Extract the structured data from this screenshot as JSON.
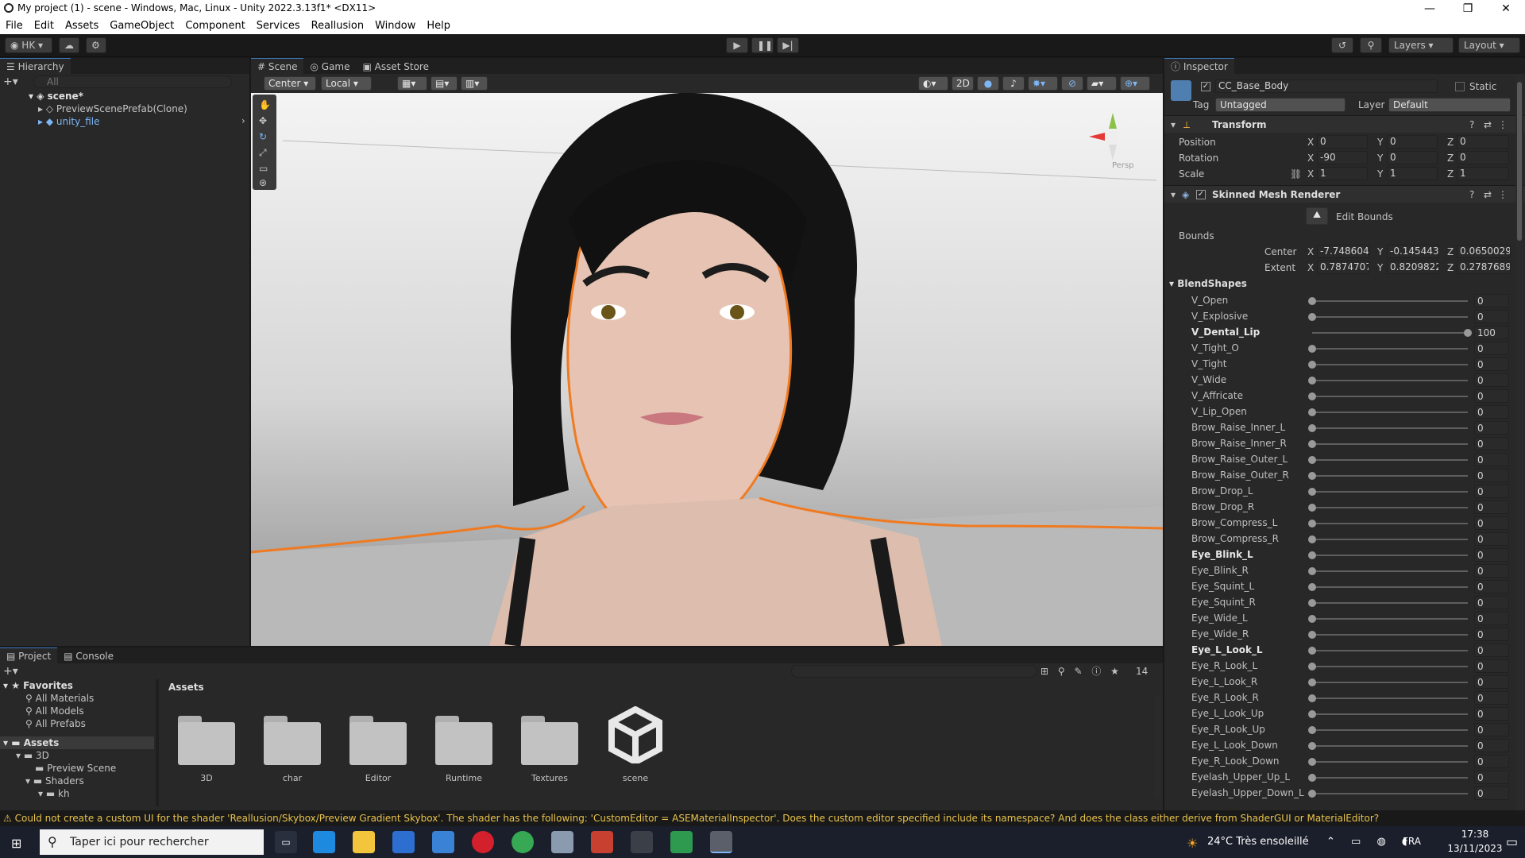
{
  "window": {
    "title": "My project (1) - scene - Windows, Mac, Linux - Unity 2022.3.13f1* <DX11>",
    "minimize": "—",
    "maximize": "❐",
    "close": "✕"
  },
  "menu": [
    "File",
    "Edit",
    "Assets",
    "GameObject",
    "Component",
    "Services",
    "Reallusion",
    "Window",
    "Help"
  ],
  "toolbar": {
    "account": "HK",
    "layers": "Layers",
    "layout": "Layout"
  },
  "hierarchy": {
    "tab": "Hierarchy",
    "search_placeholder": "All",
    "scene": "scene*",
    "items": [
      "PreviewScenePrefab(Clone)",
      "unity_file"
    ]
  },
  "scene_view": {
    "tabs": [
      "Scene",
      "Game",
      "Asset Store"
    ],
    "pivot": "Center",
    "space": "Local",
    "mode_2d": "2D",
    "persp_label": "Persp"
  },
  "inspector": {
    "tab": "Inspector",
    "object_name": "CC_Base_Body",
    "static_label": "Static",
    "tag_label": "Tag",
    "tag_value": "Untagged",
    "layer_label": "Layer",
    "layer_value": "Default",
    "transform": {
      "title": "Transform",
      "position": {
        "label": "Position",
        "x": "0",
        "y": "0",
        "z": "0"
      },
      "rotation": {
        "label": "Rotation",
        "x": "-90",
        "y": "0",
        "z": "0"
      },
      "scale": {
        "label": "Scale",
        "x": "1",
        "y": "1",
        "z": "1"
      }
    },
    "smr": {
      "title": "Skinned Mesh Renderer",
      "edit_bounds": "Edit Bounds",
      "bounds_label": "Bounds",
      "center": {
        "label": "Center",
        "x": "-7.748604",
        "y": "-0.145443",
        "z": "0.0650029"
      },
      "extent": {
        "label": "Extent",
        "x": "0.7874707",
        "y": "0.8209822",
        "z": "0.2787689"
      }
    },
    "blendshapes_title": "BlendShapes",
    "blendshapes": [
      {
        "name": "V_Open",
        "value": 0,
        "bold": false
      },
      {
        "name": "V_Explosive",
        "value": 0,
        "bold": false
      },
      {
        "name": "V_Dental_Lip",
        "value": 100,
        "bold": true
      },
      {
        "name": "V_Tight_O",
        "value": 0,
        "bold": false
      },
      {
        "name": "V_Tight",
        "value": 0,
        "bold": false
      },
      {
        "name": "V_Wide",
        "value": 0,
        "bold": false
      },
      {
        "name": "V_Affricate",
        "value": 0,
        "bold": false
      },
      {
        "name": "V_Lip_Open",
        "value": 0,
        "bold": false
      },
      {
        "name": "Brow_Raise_Inner_L",
        "value": 0,
        "bold": false
      },
      {
        "name": "Brow_Raise_Inner_R",
        "value": 0,
        "bold": false
      },
      {
        "name": "Brow_Raise_Outer_L",
        "value": 0,
        "bold": false
      },
      {
        "name": "Brow_Raise_Outer_R",
        "value": 0,
        "bold": false
      },
      {
        "name": "Brow_Drop_L",
        "value": 0,
        "bold": false
      },
      {
        "name": "Brow_Drop_R",
        "value": 0,
        "bold": false
      },
      {
        "name": "Brow_Compress_L",
        "value": 0,
        "bold": false
      },
      {
        "name": "Brow_Compress_R",
        "value": 0,
        "bold": false
      },
      {
        "name": "Eye_Blink_L",
        "value": 0,
        "bold": true
      },
      {
        "name": "Eye_Blink_R",
        "value": 0,
        "bold": false
      },
      {
        "name": "Eye_Squint_L",
        "value": 0,
        "bold": false
      },
      {
        "name": "Eye_Squint_R",
        "value": 0,
        "bold": false
      },
      {
        "name": "Eye_Wide_L",
        "value": 0,
        "bold": false
      },
      {
        "name": "Eye_Wide_R",
        "value": 0,
        "bold": false
      },
      {
        "name": "Eye_L_Look_L",
        "value": 0,
        "bold": true
      },
      {
        "name": "Eye_R_Look_L",
        "value": 0,
        "bold": false
      },
      {
        "name": "Eye_L_Look_R",
        "value": 0,
        "bold": false
      },
      {
        "name": "Eye_R_Look_R",
        "value": 0,
        "bold": false
      },
      {
        "name": "Eye_L_Look_Up",
        "value": 0,
        "bold": false
      },
      {
        "name": "Eye_R_Look_Up",
        "value": 0,
        "bold": false
      },
      {
        "name": "Eye_L_Look_Down",
        "value": 0,
        "bold": false
      },
      {
        "name": "Eye_R_Look_Down",
        "value": 0,
        "bold": false
      },
      {
        "name": "Eyelash_Upper_Up_L",
        "value": 0,
        "bold": false
      },
      {
        "name": "Eyelash_Upper_Down_L",
        "value": 0,
        "bold": false
      }
    ]
  },
  "project": {
    "tabs": [
      "Project",
      "Console"
    ],
    "favorites_label": "Favorites",
    "favorites": [
      "All Materials",
      "All Models",
      "All Prefabs"
    ],
    "assets_label": "Assets",
    "tree": [
      "3D",
      "Preview Scene",
      "Shaders",
      "kh"
    ],
    "breadcrumb": "Assets",
    "hidden_count": "14",
    "items": [
      "3D",
      "char",
      "Editor",
      "Runtime",
      "Textures",
      "scene"
    ]
  },
  "status": {
    "message": "Could not create a custom UI for the shader 'Reallusion/Skybox/Preview Gradient Skybox'. The shader has the following: 'CustomEditor = ASEMaterialInspector'. Does the custom editor specified include its namespace? And does the class either derive from ShaderGUI or MaterialEditor?"
  },
  "taskbar": {
    "search_placeholder": "Taper ici pour rechercher",
    "weather": "24°C  Très ensoleillé",
    "lang": "FRA",
    "time": "17:38",
    "date": "13/11/2023"
  }
}
